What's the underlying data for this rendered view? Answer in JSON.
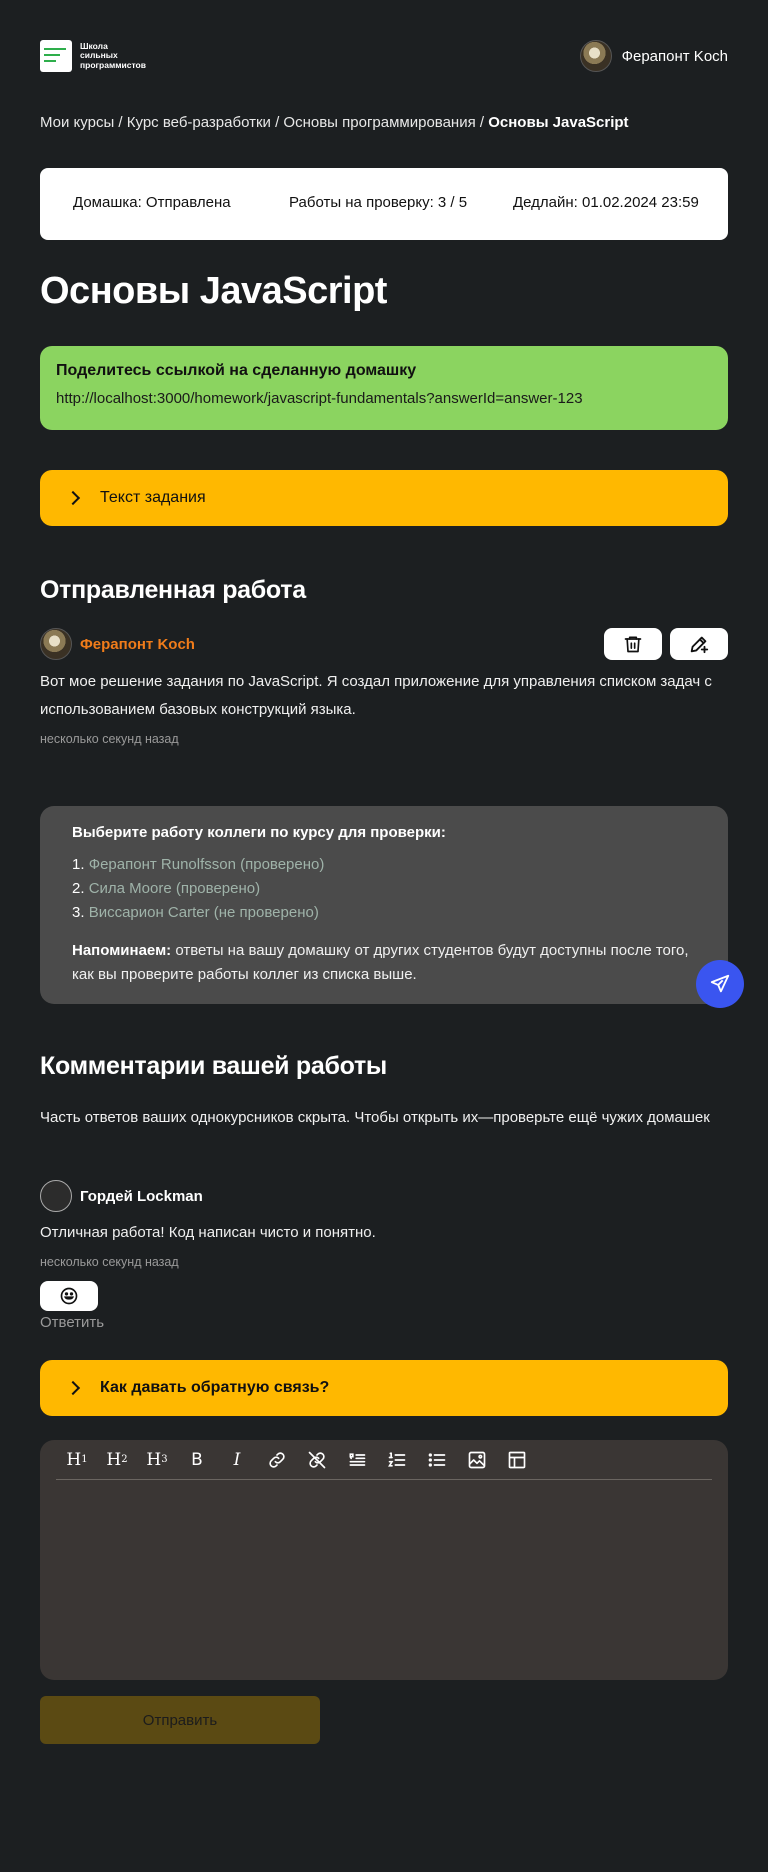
{
  "header": {
    "logo_text": [
      "Школа",
      "сильных",
      "программистов"
    ],
    "user_name": "Ферапонт Koch"
  },
  "breadcrumbs": {
    "items": [
      "Мои курсы",
      "Курс веб-разработки",
      "Основы программирования"
    ],
    "separator": " / ",
    "current": "Основы JavaScript"
  },
  "status_bar": {
    "homework": "Домашка: Отправлена",
    "reviews": "Работы на проверку: 3 / 5",
    "deadline": "Дедлайн: 01.02.2024 23:59"
  },
  "page_title": "Основы JavaScript",
  "share": {
    "heading": "Поделитесь ссылкой на сделанную домашку",
    "link": "http://localhost:3000/homework/javascript-fundamentals?answerId=answer-123"
  },
  "task_accordion": {
    "label": "Текст задания"
  },
  "submitted": {
    "heading": "Отправленная работа",
    "author": "Ферапонт Koch",
    "text": "Вот мое решение задания по JavaScript. Я создал приложение для управления списком задач с использованием базовых конструкций языка.",
    "time": "несколько секунд назад"
  },
  "review": {
    "heading": "Выберите работу коллеги по курсу для проверки:",
    "items": [
      {
        "num": "1.",
        "label": "Ферапонт Runolfsson (проверено)"
      },
      {
        "num": "2.",
        "label": "Сила Moore (проверено)"
      },
      {
        "num": "3.",
        "label": "Виссарион Carter (не проверено)"
      }
    ],
    "note_bold": "Напоминаем:",
    "note_text": " ответы на вашу домашку от других студентов будут доступны после того, как вы проверите работы коллег из списка выше."
  },
  "comments": {
    "heading": "Комментарии вашей работы",
    "hidden_note": "Часть ответов ваших однокурсников скрыта. Чтобы открыть их—проверьте ещё чужих домашек",
    "author": "Гордей Lockman",
    "text": "Отличная работа! Код написан чисто и понятно.",
    "time": "несколько секунд назад",
    "reply": "Ответить"
  },
  "feedback_accordion": {
    "label": "Как давать обратную связь?"
  },
  "editor": {
    "toolbar": [
      "heading-1-icon",
      "heading-2-icon",
      "heading-3-icon",
      "bold-icon",
      "italic-icon",
      "link-icon",
      "unlink-icon",
      "quote-icon",
      "ordered-list-icon",
      "bullet-list-icon",
      "image-icon",
      "table-icon"
    ]
  },
  "submit_label": "Отправить",
  "colors": {
    "background": "#1c1f21",
    "share_bg": "#8bd460",
    "accordion_bg": "#ffb800",
    "author_accent": "#f07c1a",
    "fab": "#3a55f0",
    "submit_disabled": "#5b4a13"
  }
}
